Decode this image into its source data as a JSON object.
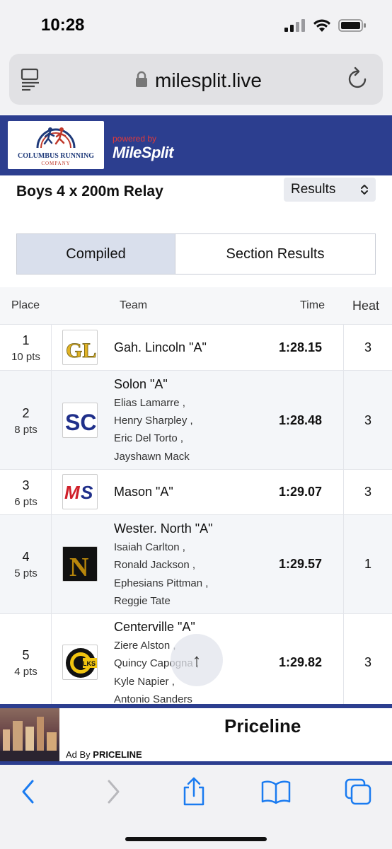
{
  "status_bar": {
    "time": "10:28"
  },
  "browser": {
    "url": "milesplit.live"
  },
  "header": {
    "logo_name": "COLUMBUS RUNNING",
    "logo_sub": "COMPANY",
    "powered_by": "powered by",
    "brand": "MileSplit"
  },
  "event": {
    "title": "Boys 4 x 200m Relay",
    "view_select": "Results"
  },
  "tabs": [
    {
      "label": "Compiled",
      "active": true
    },
    {
      "label": "Section Results",
      "active": false
    }
  ],
  "table": {
    "headers": {
      "place": "Place",
      "team": "Team",
      "time": "Time",
      "heat": "Heat"
    },
    "rows": [
      {
        "place": "1",
        "pts": "10 pts",
        "team": "Gah. Lincoln \"A\"",
        "athletes": [],
        "time": "1:28.15",
        "heat": "3",
        "logo": "GL"
      },
      {
        "place": "2",
        "pts": "8 pts",
        "team": "Solon \"A\"",
        "athletes": [
          "Elias Lamarre ,",
          "Henry Sharpley ,",
          "Eric Del Torto ,",
          "Jayshawn Mack"
        ],
        "time": "1:28.48",
        "heat": "3",
        "logo": "SC"
      },
      {
        "place": "3",
        "pts": "6 pts",
        "team": "Mason \"A\"",
        "athletes": [],
        "time": "1:29.07",
        "heat": "3",
        "logo": "MS"
      },
      {
        "place": "4",
        "pts": "5 pts",
        "team": "Wester. North \"A\"",
        "athletes": [
          "Isaiah Carlton ,",
          "Ronald Jackson ,",
          "Ephesians Pittman ,",
          "Reggie Tate"
        ],
        "time": "1:29.57",
        "heat": "1",
        "logo": "N"
      },
      {
        "place": "5",
        "pts": "4 pts",
        "team": "Centerville \"A\"",
        "athletes": [
          "Ziere Alston ,",
          "Quincy Capogna ,",
          "Kyle Napier ,",
          "Antonio Sanders"
        ],
        "time": "1:29.82",
        "heat": "3",
        "logo": "ELKS"
      }
    ]
  },
  "scroll_top": "↑",
  "ad": {
    "title": "Priceline",
    "by_label": "Ad By ",
    "by_brand": "PRICELINE"
  },
  "colors": {
    "brand_blue": "#2c3e8f",
    "accent_blue": "#1a7bf0"
  },
  "icons": [
    "reader-mode-icon",
    "lock-icon",
    "reload-icon",
    "back-icon",
    "forward-icon",
    "share-icon",
    "bookmarks-icon",
    "tabs-icon"
  ]
}
